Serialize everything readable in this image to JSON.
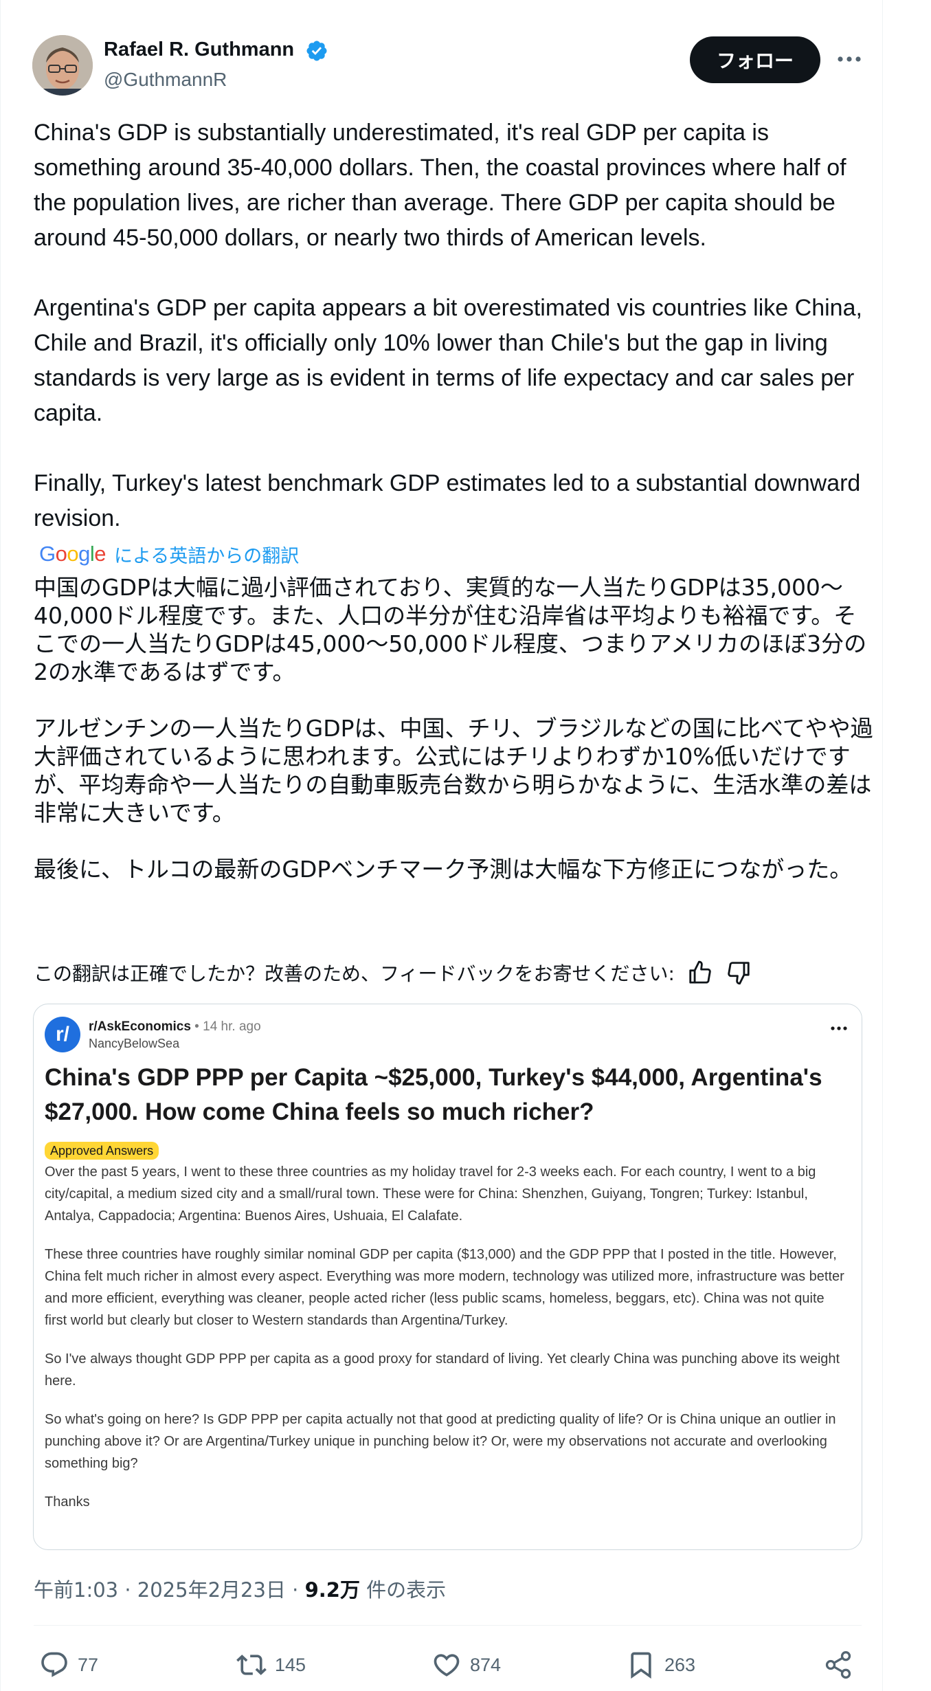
{
  "author": {
    "name": "Rafael R. Guthmann",
    "handle": "@GuthmannR",
    "verified": true
  },
  "header": {
    "follow_label": "フォロー"
  },
  "tweet": {
    "paragraphs": [
      "China's GDP is substantially underestimated, it's real GDP per capita is something around 35-40,000 dollars. Then, the coastal provinces where half of the population lives, are richer than average. There GDP per capita should be around 45-50,000 dollars, or nearly two thirds of American levels.",
      "Argentina's GDP per capita appears  a bit overestimated vis countries like China, Chile and Brazil, it's officially only 10% lower than Chile's but the gap in living standards is very large as is evident in terms of life expectacy and car sales per capita.",
      "Finally, Turkey's latest benchmark GDP estimates led to a substantial downward revision."
    ]
  },
  "translation": {
    "google_logo": "Google",
    "label": "による英語からの翻訳",
    "paragraphs": [
      "中国のGDPは大幅に過小評価されており、実質的な一人当たりGDPは35,000〜40,000ドル程度です。また、人口の半分が住む沿岸省は平均よりも裕福です。そこでの一人当たりGDPは45,000〜50,000ドル程度、つまりアメリカのほぼ3分の2の水準であるはずです。",
      "アルゼンチンの一人当たりGDPは、中国、チリ、ブラジルなどの国に比べてやや過大評価されているように思われます。公式にはチリよりわずか10%低いだけですが、平均寿命や一人当たりの自動車販売台数から明らかなように、生活水準の差は非常に大きいです。",
      "最後に、トルコの最新のGDPベンチマーク予測は大幅な下方修正につながった。"
    ],
    "feedback_prompt": "この翻訳は正確でしたか？改善のため、フィードバックをお寄せください:"
  },
  "embedded_post": {
    "logo_text": "r/",
    "subreddit": "r/AskEconomics",
    "separator": " • ",
    "time": "14 hr. ago",
    "poster": "NancyBelowSea",
    "title": "China's GDP PPP per Capita ~$25,000, Turkey's $44,000, Argentina's $27,000. How come China feels so much richer?",
    "flair": "Approved Answers",
    "paragraphs": [
      "Over the past 5 years, I went to these three countries as my holiday travel for 2-3 weeks each. For each country, I went to a big city/capital, a medium sized city and a small/rural town. These were for China: Shenzhen, Guiyang, Tongren; Turkey: Istanbul, Antalya, Cappadocia; Argentina: Buenos Aires, Ushuaia, El Calafate.",
      "These three countries have roughly similar nominal GDP per capita ($13,000) and the GDP PPP that I posted in the title. However, China felt much richer in almost every aspect. Everything was more modern, technology was utilized more, infrastructure was better and more efficient, everything was cleaner, people acted richer (less public scams, homeless, beggars, etc). China was not quite first world but clearly but closer to Western standards than Argentina/Turkey.",
      "So I've always thought GDP PPP per capita as a good proxy for standard of living. Yet clearly China was punching above its weight here.",
      "So what's going on here? Is GDP PPP per capita actually not that good at predicting quality of life? Or is China unique an outlier in punching above it? Or are Argentina/Turkey unique in punching below it? Or, were my observations not accurate and overlooking something big?",
      "Thanks"
    ]
  },
  "meta": {
    "time": "午前1:03",
    "dot": " · ",
    "date": "2025年2月23日",
    "views": "9.2万",
    "views_suffix": " 件の表示"
  },
  "actions": {
    "replies": "77",
    "reposts": "145",
    "likes": "874",
    "bookmarks": "263"
  },
  "colors": {
    "accent": "#1d9bf0",
    "text": "#0f1419",
    "secondary": "#536471",
    "flair": "#ffd635",
    "reddit_blue": "#1f6fde"
  }
}
